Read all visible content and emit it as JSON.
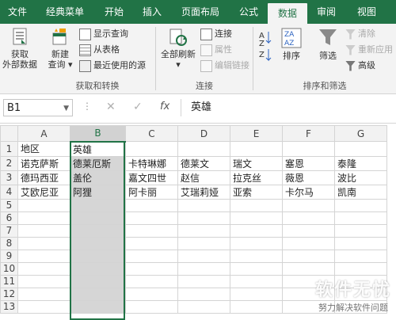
{
  "tabs": [
    "文件",
    "经典菜单",
    "开始",
    "插入",
    "页面布局",
    "公式",
    "数据",
    "审阅",
    "视图"
  ],
  "active_tab": "数据",
  "ribbon": {
    "get_external": {
      "line1": "获取",
      "line2": "外部数据"
    },
    "new_query": {
      "line1": "新建",
      "line2": "查询"
    },
    "show_query": "显示查询",
    "from_table": "从表格",
    "recent_sources": "最近使用的源",
    "group1_label": "获取和转换",
    "refresh_all": "全部刷新",
    "connections": "连接",
    "properties": "属性",
    "edit_links": "编辑链接",
    "group2_label": "连接",
    "sort": "排序",
    "filter": "筛选",
    "clear": "清除",
    "reapply": "重新应用",
    "advanced": "高级",
    "group3_label": "排序和筛选"
  },
  "formula_bar": {
    "namebox": "B1",
    "formula": "英雄"
  },
  "columns": [
    "A",
    "B",
    "C",
    "D",
    "E",
    "F",
    "G"
  ],
  "rows": [
    [
      "地区",
      "英雄",
      "",
      "",
      "",
      "",
      ""
    ],
    [
      "诺克萨斯",
      "德莱厄斯",
      "卡特琳娜",
      "德莱文",
      "瑞文",
      "塞恩",
      "泰隆"
    ],
    [
      "德玛西亚",
      "盖伦",
      "嘉文四世",
      "赵信",
      "拉克丝",
      "薇恩",
      "波比"
    ],
    [
      "艾欧尼亚",
      "阿狸",
      "阿卡丽",
      "艾瑞莉娅",
      "亚索",
      "卡尔马",
      "凯南"
    ],
    [
      "",
      "",
      "",
      "",
      "",
      "",
      ""
    ],
    [
      "",
      "",
      "",
      "",
      "",
      "",
      ""
    ],
    [
      "",
      "",
      "",
      "",
      "",
      "",
      ""
    ],
    [
      "",
      "",
      "",
      "",
      "",
      "",
      ""
    ],
    [
      "",
      "",
      "",
      "",
      "",
      "",
      ""
    ],
    [
      "",
      "",
      "",
      "",
      "",
      "",
      ""
    ],
    [
      "",
      "",
      "",
      "",
      "",
      "",
      ""
    ],
    [
      "",
      "",
      "",
      "",
      "",
      "",
      ""
    ],
    [
      "",
      "",
      "",
      "",
      "",
      "",
      ""
    ]
  ],
  "row_numbers": [
    "1",
    "2",
    "3",
    "4",
    "5",
    "6",
    "7",
    "8",
    "9",
    "10",
    "11",
    "12",
    "13"
  ],
  "watermark": {
    "title": "软件无忧",
    "subtitle": "努力解决软件问题"
  },
  "colors": {
    "excel_green": "#217346",
    "selection_gray": "#d6d6d6"
  }
}
